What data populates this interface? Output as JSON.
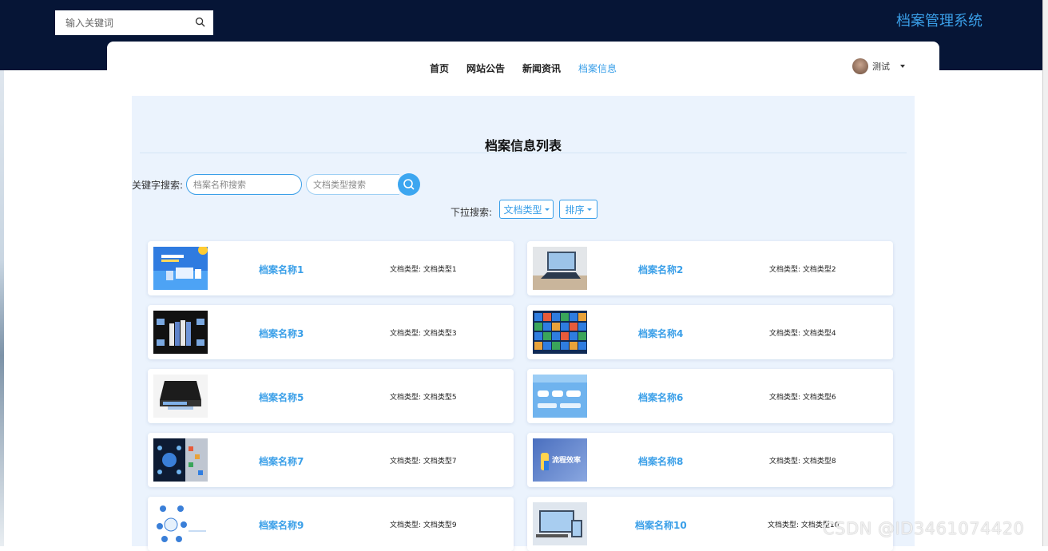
{
  "header": {
    "search_placeholder": "输入关键词",
    "site_title": "档案管理系统"
  },
  "nav": {
    "items": [
      "首页",
      "网站公告",
      "新闻资讯",
      "档案信息"
    ],
    "active_index": 3
  },
  "user": {
    "name": "测试"
  },
  "main": {
    "title": "档案信息列表",
    "keyword_label": "关键字搜索:",
    "name_placeholder": "档案名称搜索",
    "type_placeholder": "文档类型搜索",
    "dropdown_label": "下拉搜索:",
    "dropdown_type": "文档类型",
    "dropdown_sort": "排序"
  },
  "cards": [
    {
      "name": "档案名称1",
      "type": "文档类型: 文档类型1",
      "thumb": "office-promo"
    },
    {
      "name": "档案名称2",
      "type": "文档类型: 文档类型2",
      "thumb": "laptop-desk"
    },
    {
      "name": "档案名称3",
      "type": "文档类型: 文档类型3",
      "thumb": "binders"
    },
    {
      "name": "档案名称4",
      "type": "文档类型: 文档类型4",
      "thumb": "tile-grid"
    },
    {
      "name": "档案名称5",
      "type": "文档类型: 文档类型5",
      "thumb": "scanner"
    },
    {
      "name": "档案名称6",
      "type": "文档类型: 文档类型6",
      "thumb": "blue-flow"
    },
    {
      "name": "档案名称7",
      "type": "文档类型: 文档类型7",
      "thumb": "dark-diagram"
    },
    {
      "name": "档案名称8",
      "type": "文档类型: 文档类型8",
      "thumb": "process-efficiency"
    },
    {
      "name": "档案名称9",
      "type": "文档类型: 文档类型9",
      "thumb": "circle-diagram"
    },
    {
      "name": "档案名称10",
      "type": "文档类型: 文档类型10",
      "thumb": "devices"
    }
  ],
  "thumb_text": {
    "process-efficiency": "流程效率"
  },
  "colors": {
    "header_bg": "#061536",
    "accent": "#3a9fe8",
    "panel_bg": "#ebf3fd"
  },
  "watermark": "CSDN @ID3461074420"
}
